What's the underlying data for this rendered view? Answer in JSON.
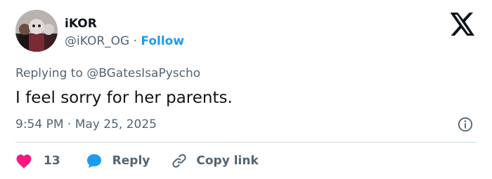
{
  "author": {
    "name": "iKOR",
    "handle": "@iKOR_OG",
    "separator": "·",
    "follow_label": "Follow"
  },
  "reply_context": {
    "prefix": "Replying to",
    "mention": "@BGatesIsaPyscho"
  },
  "tweet": {
    "text": "I feel sorry for her parents.",
    "timestamp": "9:54 PM · May 25, 2025"
  },
  "actions": {
    "like_count": "13",
    "reply_label": "Reply",
    "copy_link_label": "Copy link"
  },
  "icons": {
    "logo": "x-logo-icon",
    "info": "info-icon",
    "like": "heart-icon",
    "reply": "speech-bubble-icon",
    "copy": "link-icon"
  },
  "colors": {
    "accent": "#1d9bf0",
    "like": "#f91880",
    "text": "#0f1419",
    "muted": "#536471",
    "divider": "#cfd9de"
  }
}
